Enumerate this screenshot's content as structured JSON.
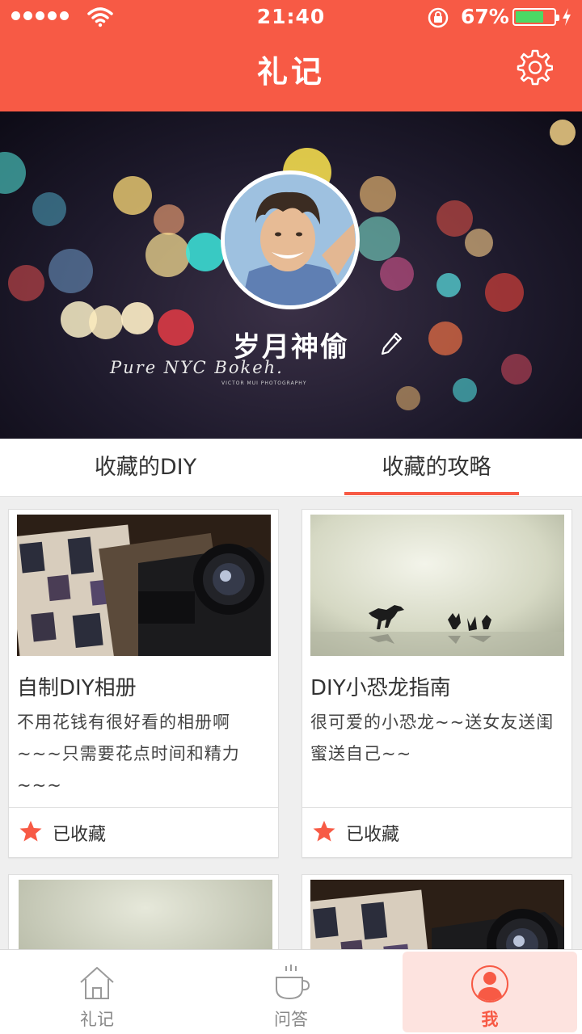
{
  "status_bar": {
    "time": "21:40",
    "battery_percent": "67%"
  },
  "header": {
    "title": "礼记"
  },
  "profile": {
    "username": "岁月神偷",
    "watermark": "Pure NYC Bokeh.",
    "watermark_sub": "VICTOR MUI PHOTOGRAPHY"
  },
  "tabs": [
    {
      "label": "收藏的DIY",
      "active": false
    },
    {
      "label": "收藏的攻略",
      "active": true
    }
  ],
  "cards": [
    {
      "title": "自制DIY相册",
      "desc": "不用花钱有很好看的相册啊~~~只需要花点时间和精力~~~",
      "fav_label": "已收藏"
    },
    {
      "title": "DIY小恐龙指南",
      "desc": "很可爱的小恐龙~~送女友送闺蜜送自己~~",
      "fav_label": "已收藏"
    }
  ],
  "bottom_nav": [
    {
      "label": "礼记",
      "icon": "home-icon",
      "active": false
    },
    {
      "label": "问答",
      "icon": "cup-icon",
      "active": false
    },
    {
      "label": "我",
      "icon": "user-icon",
      "active": true
    }
  ],
  "colors": {
    "accent": "#f75a45",
    "active_nav_bg": "#fde3df"
  }
}
